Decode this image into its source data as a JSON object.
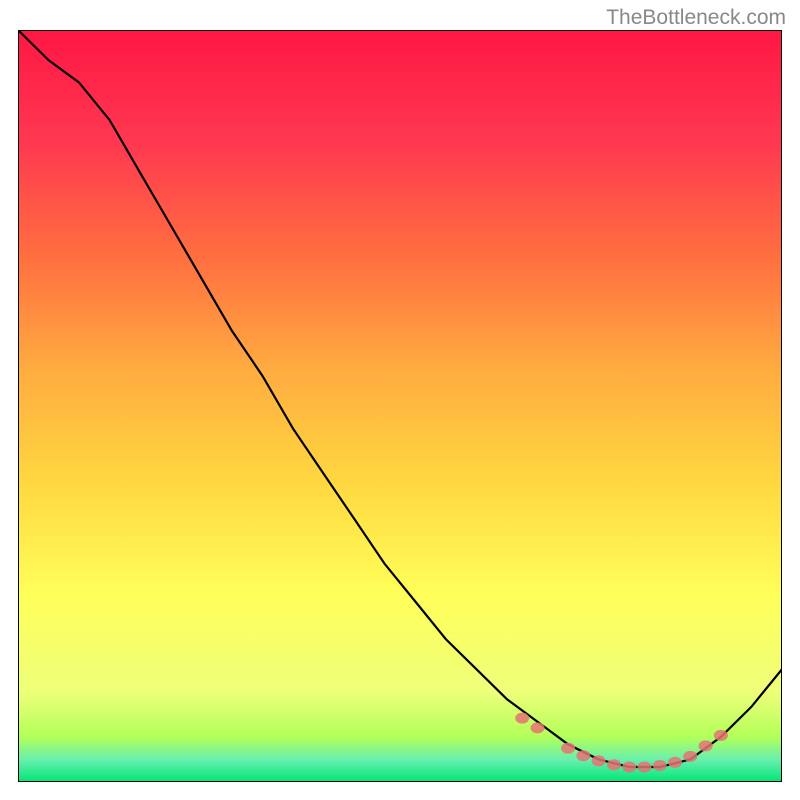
{
  "watermark": "TheBottleneck.com",
  "chart_data": {
    "type": "line",
    "title": "",
    "xlabel": "",
    "ylabel": "",
    "xlim": [
      0,
      100
    ],
    "ylim": [
      0,
      100
    ],
    "series": [
      {
        "name": "curve",
        "x": [
          0,
          4,
          8,
          12,
          16,
          20,
          24,
          28,
          32,
          36,
          40,
          44,
          48,
          52,
          56,
          60,
          64,
          68,
          72,
          76,
          80,
          84,
          88,
          92,
          96,
          100
        ],
        "y": [
          100,
          96,
          93,
          88,
          81,
          74,
          67,
          60,
          54,
          47,
          41,
          35,
          29,
          24,
          19,
          15,
          11,
          8,
          5,
          3,
          2,
          2,
          3,
          6,
          10,
          15
        ]
      }
    ],
    "markers": {
      "name": "dots",
      "x": [
        66,
        68,
        72,
        74,
        76,
        78,
        80,
        82,
        84,
        86,
        88,
        90,
        92
      ],
      "y": [
        8.5,
        7.2,
        4.5,
        3.5,
        2.8,
        2.3,
        2.0,
        2.0,
        2.2,
        2.6,
        3.4,
        4.8,
        6.2
      ]
    },
    "gradient_stops": [
      {
        "offset": 0,
        "color": "#ff1744"
      },
      {
        "offset": 15,
        "color": "#ff3850"
      },
      {
        "offset": 30,
        "color": "#ff6e40"
      },
      {
        "offset": 45,
        "color": "#ffab40"
      },
      {
        "offset": 60,
        "color": "#ffd740"
      },
      {
        "offset": 75,
        "color": "#ffff59"
      },
      {
        "offset": 88,
        "color": "#eeff7a"
      },
      {
        "offset": 94,
        "color": "#b2ff59"
      },
      {
        "offset": 97,
        "color": "#69f0ae"
      },
      {
        "offset": 100,
        "color": "#00e676"
      }
    ]
  }
}
